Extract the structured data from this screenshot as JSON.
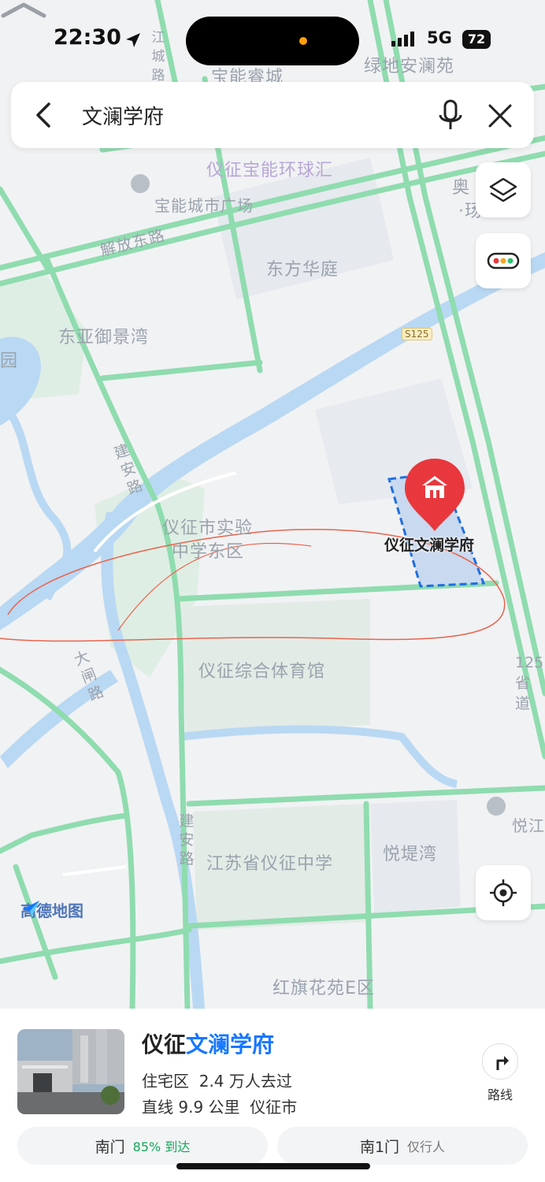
{
  "status_bar": {
    "time": "22:30",
    "network": "5G",
    "battery": "72"
  },
  "search": {
    "query": "文澜学府"
  },
  "map": {
    "labels": {
      "baoneng_ruicheng": "宝能睿城",
      "lvdi_anlan": "绿地安澜苑",
      "yizheng_baoneng_huanqiu": "仪征宝能环球汇",
      "baoneng_city_plaza": "宝能城市广场",
      "aoti_1": "奥",
      "aoti_2": "·玚",
      "jiefang_road": "解放东路",
      "dongfang_huating": "东方华庭",
      "dongya_yujingwan": "东亚御景湾",
      "yuan": "园",
      "s125": "S125",
      "jianan_road_1": "建安路",
      "yizheng_shiyan": "仪征市实验",
      "zhongxue_dongqu": "中学东区",
      "target_pin": "仪征文澜学府",
      "sports_hall": "仪征综合体育馆",
      "dazha_road": "大闸路",
      "route_125": "125省道",
      "yuejiang": "悦江",
      "jianan_road_2": "建安路",
      "jiangsu_yizheng_school": "江苏省仪征中学",
      "yueti_wan": "悦堤湾",
      "logo": "高德地图",
      "hongqi_huayuan": "红旗花苑E区",
      "jiang_cheng_road": "江城路"
    }
  },
  "place": {
    "title_prefix": "仪征",
    "title_highlight": "文澜学府",
    "category": "住宅区",
    "visitors": "2.4 万人去过",
    "distance": "直线 9.9 公里",
    "city": "仪征市",
    "route_label": "路线",
    "gates": [
      {
        "name": "南门",
        "note": "85% 到达"
      },
      {
        "name": "南1门",
        "note": "仅行人"
      }
    ]
  },
  "colors": {
    "accent": "#1677ff",
    "road": "#8fdcaf",
    "water": "#b9d8f3",
    "pin": "#e8383d"
  }
}
